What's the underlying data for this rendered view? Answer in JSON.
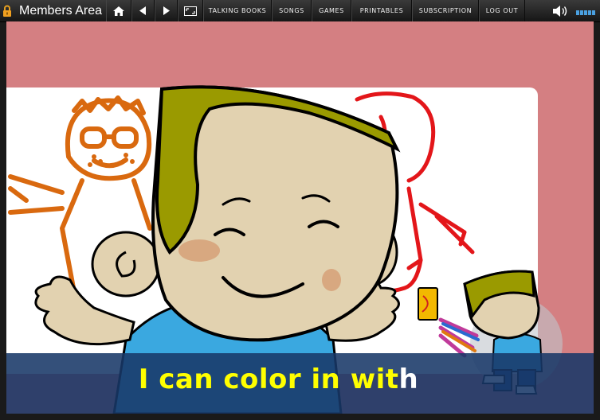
{
  "header": {
    "title": "Members Area",
    "menu": [
      "TALKING BOOKS",
      "SONGS",
      "GAMES",
      "PRINTABLES",
      "SUBSCRIPTION",
      "LOG OUT"
    ]
  },
  "caption": {
    "highlighted": "I can color in wit",
    "remaining": "h"
  },
  "colors": {
    "frame_background": "#d47f82",
    "caption_highlight": "#ffff00",
    "caption_bar": "#183868",
    "character_hair": "#9a9a00",
    "character_skin": "#e2d2b0",
    "shirt": "#3aa8e0"
  },
  "icons": [
    "lock-icon",
    "home-icon",
    "back-arrow-icon",
    "forward-arrow-icon",
    "fullscreen-icon",
    "speaker-icon",
    "volume-bars-icon"
  ]
}
